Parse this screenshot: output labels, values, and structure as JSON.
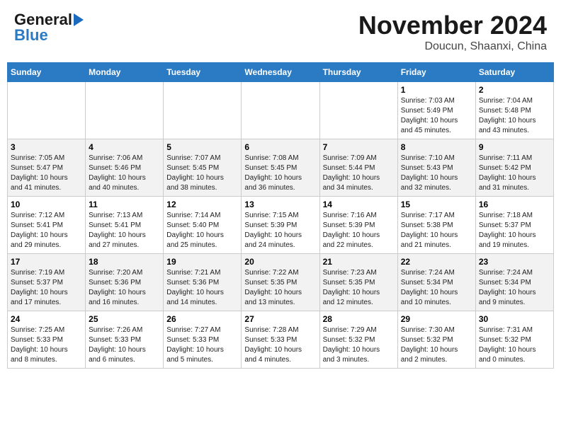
{
  "header": {
    "logo_top": "General",
    "logo_bottom": "Blue",
    "month_year": "November 2024",
    "location": "Doucun, Shaanxi, China"
  },
  "days_of_week": [
    "Sunday",
    "Monday",
    "Tuesday",
    "Wednesday",
    "Thursday",
    "Friday",
    "Saturday"
  ],
  "weeks": [
    [
      {
        "day": "",
        "info": ""
      },
      {
        "day": "",
        "info": ""
      },
      {
        "day": "",
        "info": ""
      },
      {
        "day": "",
        "info": ""
      },
      {
        "day": "",
        "info": ""
      },
      {
        "day": "1",
        "info": "Sunrise: 7:03 AM\nSunset: 5:49 PM\nDaylight: 10 hours\nand 45 minutes."
      },
      {
        "day": "2",
        "info": "Sunrise: 7:04 AM\nSunset: 5:48 PM\nDaylight: 10 hours\nand 43 minutes."
      }
    ],
    [
      {
        "day": "3",
        "info": "Sunrise: 7:05 AM\nSunset: 5:47 PM\nDaylight: 10 hours\nand 41 minutes."
      },
      {
        "day": "4",
        "info": "Sunrise: 7:06 AM\nSunset: 5:46 PM\nDaylight: 10 hours\nand 40 minutes."
      },
      {
        "day": "5",
        "info": "Sunrise: 7:07 AM\nSunset: 5:45 PM\nDaylight: 10 hours\nand 38 minutes."
      },
      {
        "day": "6",
        "info": "Sunrise: 7:08 AM\nSunset: 5:45 PM\nDaylight: 10 hours\nand 36 minutes."
      },
      {
        "day": "7",
        "info": "Sunrise: 7:09 AM\nSunset: 5:44 PM\nDaylight: 10 hours\nand 34 minutes."
      },
      {
        "day": "8",
        "info": "Sunrise: 7:10 AM\nSunset: 5:43 PM\nDaylight: 10 hours\nand 32 minutes."
      },
      {
        "day": "9",
        "info": "Sunrise: 7:11 AM\nSunset: 5:42 PM\nDaylight: 10 hours\nand 31 minutes."
      }
    ],
    [
      {
        "day": "10",
        "info": "Sunrise: 7:12 AM\nSunset: 5:41 PM\nDaylight: 10 hours\nand 29 minutes."
      },
      {
        "day": "11",
        "info": "Sunrise: 7:13 AM\nSunset: 5:41 PM\nDaylight: 10 hours\nand 27 minutes."
      },
      {
        "day": "12",
        "info": "Sunrise: 7:14 AM\nSunset: 5:40 PM\nDaylight: 10 hours\nand 25 minutes."
      },
      {
        "day": "13",
        "info": "Sunrise: 7:15 AM\nSunset: 5:39 PM\nDaylight: 10 hours\nand 24 minutes."
      },
      {
        "day": "14",
        "info": "Sunrise: 7:16 AM\nSunset: 5:39 PM\nDaylight: 10 hours\nand 22 minutes."
      },
      {
        "day": "15",
        "info": "Sunrise: 7:17 AM\nSunset: 5:38 PM\nDaylight: 10 hours\nand 21 minutes."
      },
      {
        "day": "16",
        "info": "Sunrise: 7:18 AM\nSunset: 5:37 PM\nDaylight: 10 hours\nand 19 minutes."
      }
    ],
    [
      {
        "day": "17",
        "info": "Sunrise: 7:19 AM\nSunset: 5:37 PM\nDaylight: 10 hours\nand 17 minutes."
      },
      {
        "day": "18",
        "info": "Sunrise: 7:20 AM\nSunset: 5:36 PM\nDaylight: 10 hours\nand 16 minutes."
      },
      {
        "day": "19",
        "info": "Sunrise: 7:21 AM\nSunset: 5:36 PM\nDaylight: 10 hours\nand 14 minutes."
      },
      {
        "day": "20",
        "info": "Sunrise: 7:22 AM\nSunset: 5:35 PM\nDaylight: 10 hours\nand 13 minutes."
      },
      {
        "day": "21",
        "info": "Sunrise: 7:23 AM\nSunset: 5:35 PM\nDaylight: 10 hours\nand 12 minutes."
      },
      {
        "day": "22",
        "info": "Sunrise: 7:24 AM\nSunset: 5:34 PM\nDaylight: 10 hours\nand 10 minutes."
      },
      {
        "day": "23",
        "info": "Sunrise: 7:24 AM\nSunset: 5:34 PM\nDaylight: 10 hours\nand 9 minutes."
      }
    ],
    [
      {
        "day": "24",
        "info": "Sunrise: 7:25 AM\nSunset: 5:33 PM\nDaylight: 10 hours\nand 8 minutes."
      },
      {
        "day": "25",
        "info": "Sunrise: 7:26 AM\nSunset: 5:33 PM\nDaylight: 10 hours\nand 6 minutes."
      },
      {
        "day": "26",
        "info": "Sunrise: 7:27 AM\nSunset: 5:33 PM\nDaylight: 10 hours\nand 5 minutes."
      },
      {
        "day": "27",
        "info": "Sunrise: 7:28 AM\nSunset: 5:33 PM\nDaylight: 10 hours\nand 4 minutes."
      },
      {
        "day": "28",
        "info": "Sunrise: 7:29 AM\nSunset: 5:32 PM\nDaylight: 10 hours\nand 3 minutes."
      },
      {
        "day": "29",
        "info": "Sunrise: 7:30 AM\nSunset: 5:32 PM\nDaylight: 10 hours\nand 2 minutes."
      },
      {
        "day": "30",
        "info": "Sunrise: 7:31 AM\nSunset: 5:32 PM\nDaylight: 10 hours\nand 0 minutes."
      }
    ]
  ]
}
